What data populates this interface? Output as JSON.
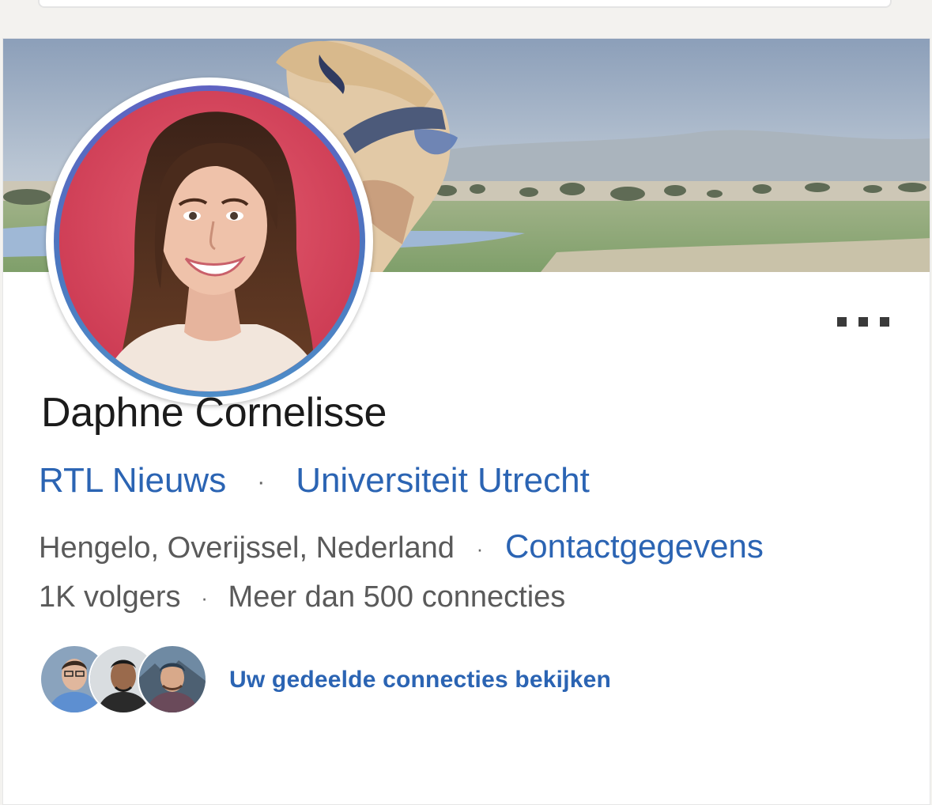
{
  "profile": {
    "name": "Daphne Cornelisse",
    "headline": {
      "company": "RTL Nieuws",
      "separator": "·",
      "education": "Universiteit Utrecht"
    },
    "location": "Hengelo, Overijssel, Nederland",
    "contact_link": "Contactgegevens",
    "followers": "1K volgers",
    "connections": "Meer dan 500 connecties",
    "shared_connections_link": "Uw gedeelde connecties bekijken"
  },
  "colors": {
    "link": "#2b64b3",
    "text_primary": "#1b1b1b",
    "text_secondary": "#5a5a5a",
    "avatar_ring": "#5f63c2",
    "avatar_background": "#d94b60"
  },
  "icons": {
    "more": "more-horizontal-icon"
  }
}
